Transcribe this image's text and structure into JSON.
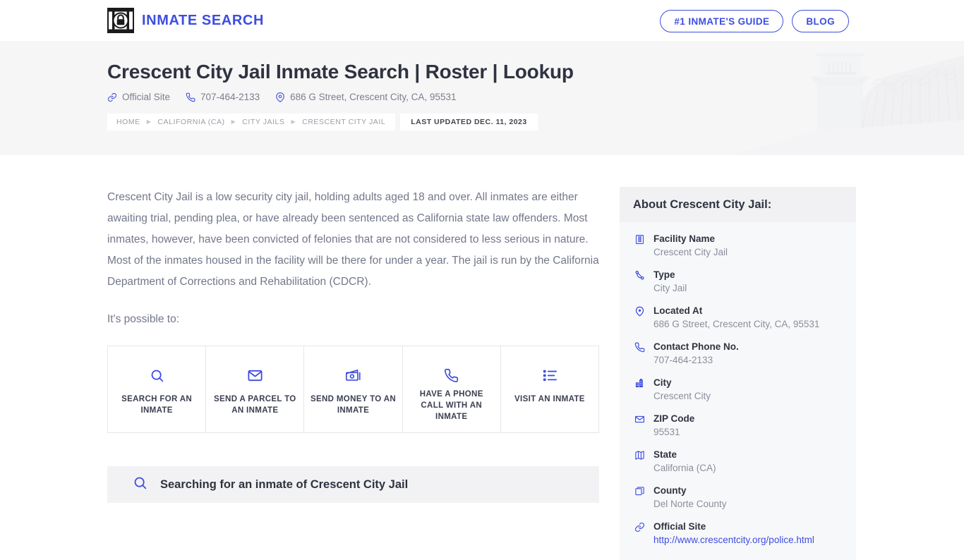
{
  "header": {
    "brand_name": "INMATE SEARCH",
    "logo_icon": "jail-bars-padlock-icon",
    "buttons": [
      {
        "label": "#1 INMATE'S GUIDE",
        "name": "inmates-guide-button"
      },
      {
        "label": "BLOG",
        "name": "blog-button"
      }
    ]
  },
  "hero": {
    "title": "Crescent City Jail Inmate Search | Roster | Lookup",
    "art_alt": "prison-guard-tower-fence-watermark",
    "meta": [
      {
        "icon": "link-icon",
        "label": "Official Site"
      },
      {
        "icon": "phone-icon",
        "label": "707-464-2133"
      },
      {
        "icon": "map-pin-icon",
        "label": "686 G Street, Crescent City, CA, 95531"
      }
    ],
    "breadcrumbs": [
      "HOME",
      "CALIFORNIA (CA)",
      "CITY JAILS",
      "CRESCENT CITY JAIL"
    ],
    "breadcrumb_separator": "▶",
    "last_updated": "LAST UPDATED DEC. 11, 2023"
  },
  "main": {
    "paragraphs": [
      "Crescent City Jail is a low security city jail, holding adults aged 18 and over. All inmates are either awaiting trial, pending plea, or have already been sentenced as California state law offenders. Most inmates, however, have been convicted of felonies that are not considered to less serious in nature. Most of the inmates housed in the facility will be there for under a year. The jail is run by the California Department of Corrections and Rehabilitation (CDCR).",
      "It's possible to:"
    ],
    "actions": [
      {
        "icon": "search-icon",
        "label": "SEARCH FOR AN INMATE",
        "name": "action-search-inmate"
      },
      {
        "icon": "envelope-icon",
        "label": "SEND A PARCEL TO AN INMATE",
        "name": "action-send-parcel"
      },
      {
        "icon": "money-icon",
        "label": "SEND MONEY TO AN INMATE",
        "name": "action-send-money"
      },
      {
        "icon": "phone-call-icon",
        "label": "HAVE A PHONE CALL WITH AN INMATE",
        "name": "action-phone-call"
      },
      {
        "icon": "list-icon",
        "label": "VISIT AN INMATE",
        "name": "action-visit-inmate"
      }
    ],
    "search_banner": {
      "icon": "search-icon",
      "text": "Searching for an inmate of Crescent City Jail"
    }
  },
  "sidebar": {
    "title": "About Crescent City Jail:",
    "facts": [
      {
        "icon": "building-grid-icon",
        "label": "Facility Name",
        "value": "Crescent City Jail",
        "is_link": false
      },
      {
        "icon": "node-branch-icon",
        "label": "Type",
        "value": "City Jail",
        "is_link": false
      },
      {
        "icon": "map-pin-icon",
        "label": "Located At",
        "value": "686 G Street, Crescent City, CA, 95531",
        "is_link": false
      },
      {
        "icon": "phone-icon",
        "label": "Contact Phone No.",
        "value": "707-464-2133",
        "is_link": false
      },
      {
        "icon": "city-icon",
        "label": "City",
        "value": "Crescent City",
        "is_link": false
      },
      {
        "icon": "envelope-icon",
        "label": "ZIP Code",
        "value": "95531",
        "is_link": false
      },
      {
        "icon": "map-fold-icon",
        "label": "State",
        "value": "California (CA)",
        "is_link": false
      },
      {
        "icon": "copy-icon",
        "label": "County",
        "value": "Del Norte County",
        "is_link": false
      },
      {
        "icon": "link-icon",
        "label": "Official Site",
        "value": "http://www.crescentcity.org/police.html",
        "is_link": true
      }
    ]
  },
  "colors": {
    "accent": "#3d4de0",
    "heading": "#2f3340",
    "body_text": "#73778a",
    "muted": "#9a9ea9",
    "hero_bg": "#f6f6f7",
    "panel_bg": "#f7f8fa",
    "panel_head_bg": "#f1f1f3",
    "border": "#e7e7ea"
  }
}
